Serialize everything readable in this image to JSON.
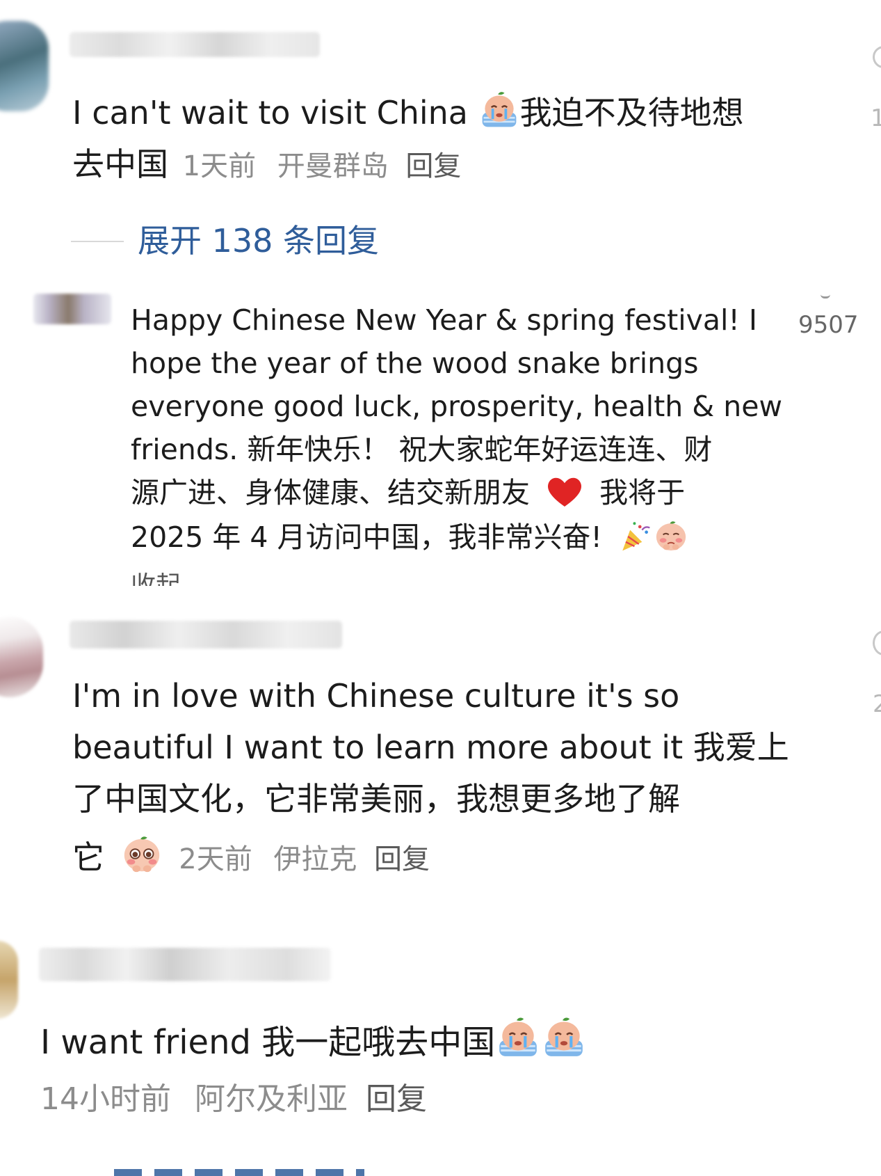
{
  "comments": [
    {
      "text": "I can't wait to visit China ",
      "text_cn_line1": "我迫不及待地想",
      "text_cn_line2": "去中国",
      "time": "1天前",
      "location": "开曼群岛",
      "reply_label": "回复",
      "expand_label": "展开 138 条回复"
    },
    {
      "line1": "Happy Chinese New Year & spring festival! I",
      "line2": "hope the year of the wood snake brings",
      "line3": "everyone good luck, prosperity, health & new",
      "line4": "friends. 新年快乐！ 祝大家蛇年好运连连、财",
      "line5": "源广进、身体健康、结交新朋友",
      "line5b": "我将于",
      "line6": "2025 年 4 月访问中国，我非常兴奋!",
      "collapse_label": "收起",
      "like_count": "9507"
    },
    {
      "line1": "I'm in love with Chinese culture it's so",
      "line2": "beautiful I want to learn more about it 我爱上",
      "line3": "了中国文化，它非常美丽，我想更多地了解",
      "line4": "它",
      "time": "2天前",
      "location": "伊拉克",
      "reply_label": "回复"
    },
    {
      "text": "I want friend 我一起哦去中国",
      "time": "14小时前",
      "location": "阿尔及利亚",
      "reply_label": "回复"
    }
  ],
  "icons": {
    "crying_emoji": "crying-emoji-icon",
    "heart": "red-heart-icon",
    "party_popper": "party-popper-icon",
    "pleading_emoji": "pleading-emoji-icon",
    "blush_emoji": "blushing-emoji-icon"
  },
  "colors": {
    "expand_link": "#2f5d9a",
    "meta_text": "#8c8c8c",
    "heart": "#e02424"
  }
}
